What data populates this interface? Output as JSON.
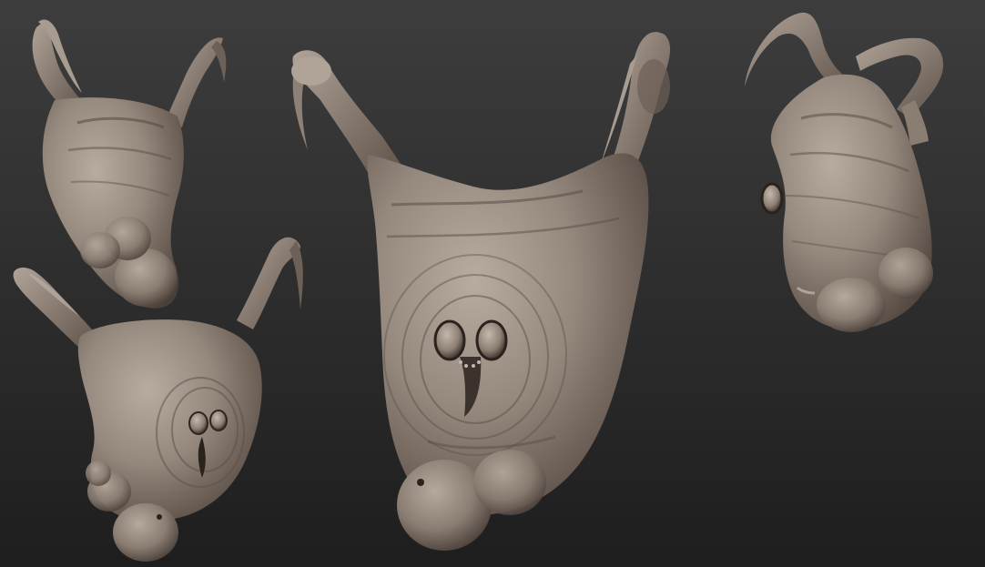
{
  "scene": {
    "background_top": "#3d3d3d",
    "background_bottom": "#1e1e1e",
    "clay_color": "#9a8d82",
    "clay_highlight": "#b8aba0",
    "clay_shadow": "#4a3f38",
    "cavity_color": "#1f1915",
    "views": [
      {
        "name": "creature-view-top-left"
      },
      {
        "name": "creature-view-bottom-left"
      },
      {
        "name": "creature-view-center"
      },
      {
        "name": "creature-view-right"
      }
    ]
  }
}
